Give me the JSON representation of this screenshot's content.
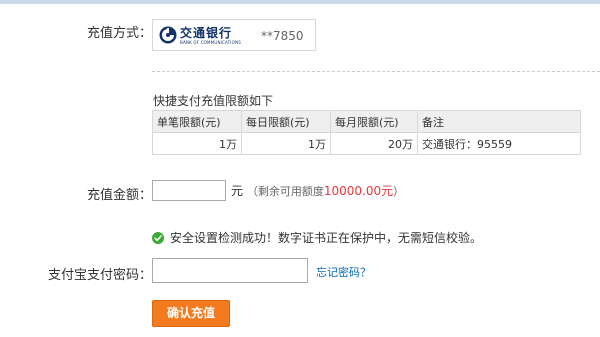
{
  "recharge_method": {
    "label": "充值方式：",
    "bank": {
      "name_cn": "交通银行",
      "name_en": "BANK OF COMMUNICATIONS",
      "card_tail": "**7850",
      "logo_icon": "bocom-logo-icon",
      "brand_color": "#14336b"
    }
  },
  "limits": {
    "title": "快捷支付充值限额如下",
    "headers": [
      "单笔限额(元)",
      "每日限额(元)",
      "每月限额(元)",
      "备注"
    ],
    "row": [
      "1万",
      "1万",
      "20万",
      "交通银行：95559"
    ]
  },
  "amount": {
    "label": "充值金额：",
    "value": "",
    "unit": "元",
    "available_prefix": "（剩余可用额度",
    "available_value": "10000.00元",
    "available_suffix": "）",
    "available_color": "#e4393c"
  },
  "security": {
    "icon": "check-circle-icon",
    "message": "安全设置检测成功！数字证书正在保护中，无需短信校验。"
  },
  "password": {
    "label": "支付宝支付密码：",
    "value": "",
    "forgot_link": "忘记密码？"
  },
  "submit": {
    "label": "确认充值",
    "color": "#f47a20"
  }
}
